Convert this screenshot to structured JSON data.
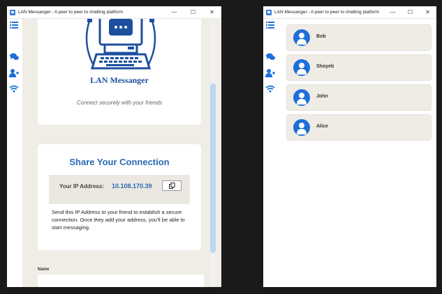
{
  "app": {
    "title": "LAN Messanger - A peer to peer to chatting platform",
    "window_controls": {
      "minimize": "—",
      "maximize": "☐",
      "close": "✕"
    }
  },
  "sidebar": {
    "icons": [
      "menu-icon",
      "chat-icon",
      "add-user-icon",
      "wifi-icon"
    ]
  },
  "home": {
    "logo_text": "LAN Messanger",
    "tagline": "Connect securely with your friends",
    "share": {
      "title": "Share Your Connection",
      "ip_label": "Your IP Address:",
      "ip_value": "10.108.170.39",
      "description": "Send this IP Address to your friend to establish a secure connection. Once they add your address, you'll be able to start messaging."
    },
    "name_label": "Name",
    "name_value": ""
  },
  "peers": [
    {
      "name": "Bob"
    },
    {
      "name": "Shoyeb"
    },
    {
      "name": "John"
    },
    {
      "name": "Alice"
    }
  ],
  "colors": {
    "accent": "#2a6ab4",
    "avatar": "#1e6fd8",
    "card_bg": "#f0ede7"
  }
}
